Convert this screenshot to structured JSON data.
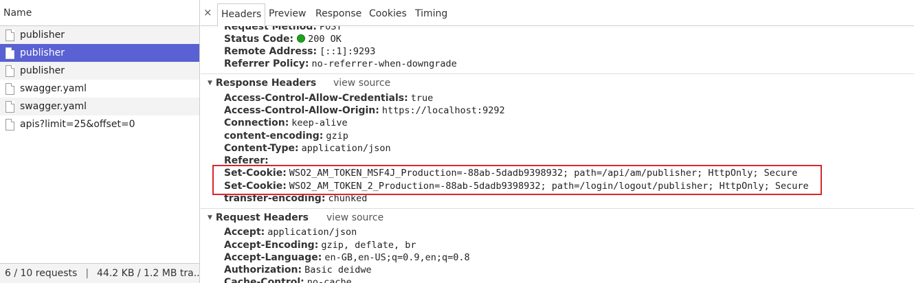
{
  "requests": {
    "column_header": "Name",
    "items": [
      {
        "name": "publisher"
      },
      {
        "name": "publisher"
      },
      {
        "name": "publisher"
      },
      {
        "name": "swagger.yaml"
      },
      {
        "name": "swagger.yaml"
      },
      {
        "name": "apis?limit=25&offset=0"
      }
    ],
    "selected_index": 1,
    "footer": {
      "requests": "6 / 10 requests",
      "separator": "|",
      "transferred": "44.2 KB / 1.2 MB tra..."
    }
  },
  "tabs": {
    "close_icon": "×",
    "items": [
      "Headers",
      "Preview",
      "Response",
      "Cookies",
      "Timing"
    ],
    "active": "Headers"
  },
  "general": {
    "request_method": {
      "key": "Request Method:",
      "value": "POST"
    },
    "status_code": {
      "key": "Status Code:",
      "value": "200 OK",
      "status_color": "#1ea31e"
    },
    "remote_address": {
      "key": "Remote Address:",
      "value": "[::1]:9293"
    },
    "referrer_policy": {
      "key": "Referrer Policy:",
      "value": "no-referrer-when-downgrade"
    }
  },
  "response_headers": {
    "title": "Response Headers",
    "view_source": "view source",
    "items": [
      {
        "key": "Access-Control-Allow-Credentials:",
        "value": "true"
      },
      {
        "key": "Access-Control-Allow-Origin:",
        "value": "https://localhost:9292"
      },
      {
        "key": "Connection:",
        "value": "keep-alive"
      },
      {
        "key": "content-encoding:",
        "value": "gzip"
      },
      {
        "key": "Content-Type:",
        "value": "application/json"
      },
      {
        "key": "Referer:",
        "value": ""
      },
      {
        "key": "Set-Cookie:",
        "value": "WSO2_AM_TOKEN_MSF4J_Production=-88ab-5dadb9398932; path=/api/am/publisher; HttpOnly; Secure"
      },
      {
        "key": "Set-Cookie:",
        "value": "WSO2_AM_TOKEN_2_Production=-88ab-5dadb9398932; path=/login/logout/publisher; HttpOnly; Secure"
      },
      {
        "key": "transfer-encoding:",
        "value": "chunked"
      }
    ]
  },
  "request_headers": {
    "title": "Request Headers",
    "view_source": "view source",
    "items": [
      {
        "key": "Accept:",
        "value": "application/json"
      },
      {
        "key": "Accept-Encoding:",
        "value": "gzip, deflate, br"
      },
      {
        "key": "Accept-Language:",
        "value": "en-GB,en-US;q=0.9,en;q=0.8"
      },
      {
        "key": "Authorization:",
        "value": "Basic deidwe"
      },
      {
        "key": "Cache-Control:",
        "value": "no-cache"
      }
    ]
  },
  "colors": {
    "selection": "#5a61d2",
    "highlight_border": "#d9262a"
  }
}
